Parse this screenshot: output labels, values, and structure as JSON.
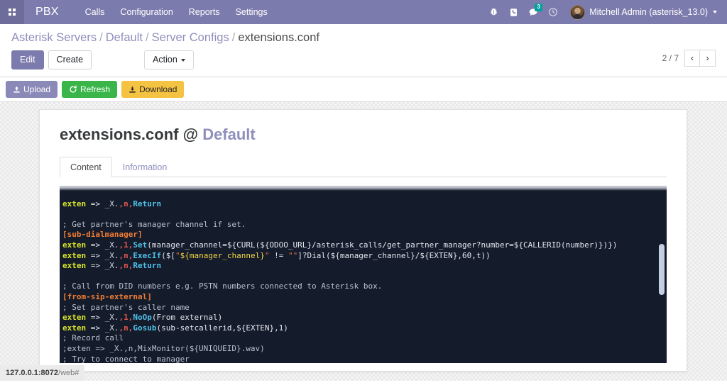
{
  "navbar": {
    "apps_icon": "apps-grid-icon",
    "brand": "PBX",
    "menu": [
      {
        "label": "Calls"
      },
      {
        "label": "Configuration"
      },
      {
        "label": "Reports"
      },
      {
        "label": "Settings"
      }
    ],
    "icons": [
      {
        "name": "bug-icon",
        "glyph": "bug"
      },
      {
        "name": "phone-icon",
        "glyph": "phone"
      },
      {
        "name": "messages-icon",
        "glyph": "chat",
        "badge": "3"
      },
      {
        "name": "activity-clock-icon",
        "glyph": "clock"
      }
    ],
    "user": {
      "name": "Mitchell Admin (asterisk_13.0)",
      "avatar": "user-avatar"
    },
    "accent_color": "#7c7bad"
  },
  "control_panel": {
    "breadcrumb": [
      {
        "label": "Asterisk Servers",
        "current": false
      },
      {
        "label": "Default",
        "current": false
      },
      {
        "label": "Server Configs",
        "current": false
      },
      {
        "label": "extensions.conf",
        "current": true
      }
    ],
    "separator": "/",
    "edit_label": "Edit",
    "create_label": "Create",
    "action_label": "Action",
    "pager": {
      "count": "2 / 7",
      "prev": "‹",
      "next": "›"
    }
  },
  "button_strip": {
    "upload": {
      "label": "Upload",
      "icon": "upload-icon",
      "color": "#8a89b8"
    },
    "refresh": {
      "label": "Refresh",
      "icon": "refresh-icon",
      "color": "#3ab54a"
    },
    "download": {
      "label": "Download",
      "icon": "download-icon",
      "color": "#f5c342"
    }
  },
  "form": {
    "title_file": "extensions.conf",
    "title_at": "@",
    "title_server": "Default",
    "tabs": [
      {
        "label": "Content",
        "active": true
      },
      {
        "label": "Information",
        "active": false
      }
    ]
  },
  "editor": {
    "background": "#141b2b",
    "scrollbar_color": "#c3cfe2",
    "lines": [
      {
        "id": "l0",
        "type": "clipped",
        "text": ""
      },
      {
        "id": "l1",
        "type": "exten",
        "text": "exten => _X.,n,Return"
      },
      {
        "id": "l2",
        "type": "blank",
        "text": ""
      },
      {
        "id": "l3",
        "type": "comment",
        "text": "; Get partner's manager channel if set."
      },
      {
        "id": "l4",
        "type": "section",
        "text": "[sub-dialmanager]"
      },
      {
        "id": "l5",
        "type": "exten",
        "text": "exten => _X.,1,Set(manager_channel=${CURL(${ODOO_URL}/asterisk_calls/get_partner_manager?number=${CALLERID(number)})})"
      },
      {
        "id": "l6",
        "type": "exten",
        "text": "exten => _X.,n,ExecIf($[\"${manager_channel}\" != \"\"]?Dial(${manager_channel}/${EXTEN},60,t))"
      },
      {
        "id": "l7",
        "type": "exten",
        "text": "exten => _X.,n,Return"
      },
      {
        "id": "l8",
        "type": "blank",
        "text": ""
      },
      {
        "id": "l9",
        "type": "comment",
        "text": "; Call from DID numbers e.g. PSTN numbers connected to Asterisk box."
      },
      {
        "id": "l10",
        "type": "section",
        "text": "[from-sip-external]"
      },
      {
        "id": "l11",
        "type": "comment",
        "text": "; Set partner's caller name"
      },
      {
        "id": "l12",
        "type": "exten",
        "text": "exten => _X.,1,NoOp(From external)"
      },
      {
        "id": "l13",
        "type": "exten",
        "text": "exten => _X.,n,Gosub(sub-setcallerid,${EXTEN},1)"
      },
      {
        "id": "l14",
        "type": "comment",
        "text": "; Record call"
      },
      {
        "id": "l15",
        "type": "comment",
        "text": ";exten => _X.,n,MixMonitor(${UNIQUEID}.wav)"
      },
      {
        "id": "l16",
        "type": "comment",
        "text": "; Try to connect to manager"
      }
    ]
  },
  "statusbar": {
    "host": "127.0.0.1:8072",
    "path": "/web#"
  }
}
